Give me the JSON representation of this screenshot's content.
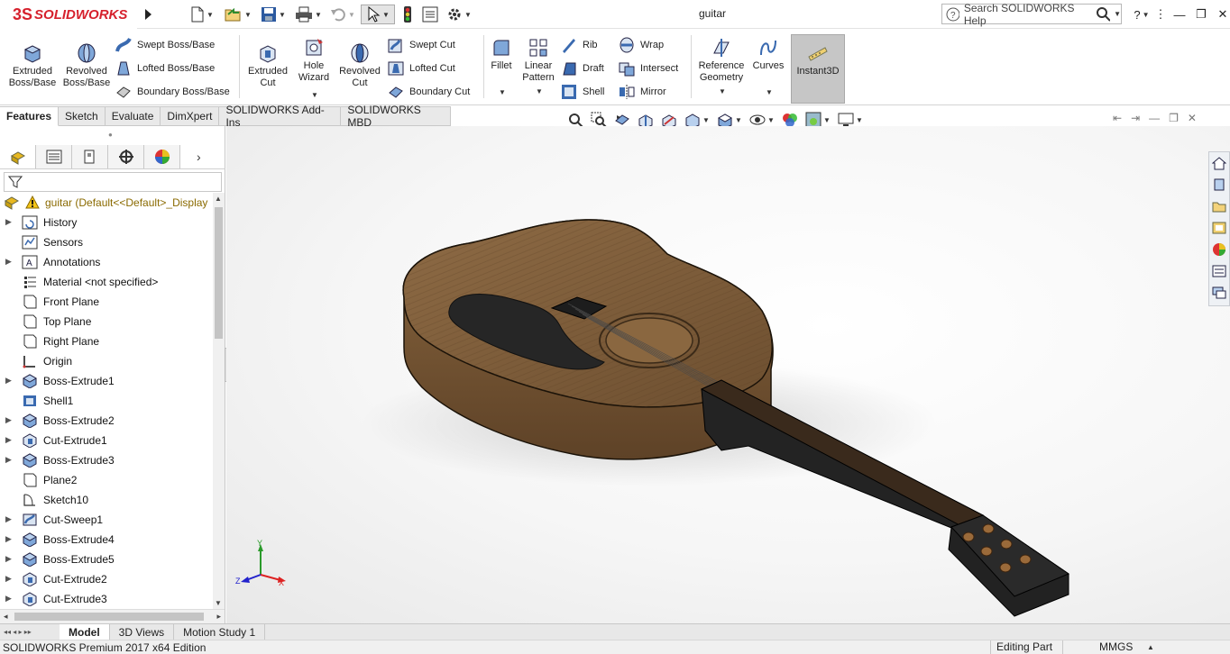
{
  "app": {
    "brand_ds": "3S",
    "brand_name": "SOLIDWORKS",
    "doc_title": "guitar",
    "search_placeholder": "Search SOLIDWORKS Help",
    "help_label": "?"
  },
  "quick_access": [
    "new-icon",
    "open-icon",
    "save-icon",
    "print-icon",
    "undo-icon",
    "select-icon",
    "rebuild-icon",
    "file-properties-icon",
    "options-icon"
  ],
  "command_manager": {
    "extruded_boss": "Extruded\nBoss/Base",
    "revolved_boss": "Revolved\nBoss/Base",
    "swept_boss": "Swept Boss/Base",
    "lofted_boss": "Lofted Boss/Base",
    "boundary_boss": "Boundary Boss/Base",
    "extruded_cut": "Extruded\nCut",
    "hole_wizard": "Hole\nWizard",
    "revolved_cut": "Revolved\nCut",
    "swept_cut": "Swept Cut",
    "lofted_cut": "Lofted Cut",
    "boundary_cut": "Boundary Cut",
    "fillet": "Fillet",
    "linear_pattern": "Linear\nPattern",
    "rib": "Rib",
    "draft": "Draft",
    "shell": "Shell",
    "wrap": "Wrap",
    "intersect": "Intersect",
    "mirror": "Mirror",
    "reference_geometry": "Reference\nGeometry",
    "curves": "Curves",
    "instant3d": "Instant3D"
  },
  "tabs": [
    "Features",
    "Sketch",
    "Evaluate",
    "DimXpert",
    "SOLIDWORKS Add-Ins",
    "SOLIDWORKS MBD"
  ],
  "active_tab": "Features",
  "tree": {
    "root": "guitar  (Default<<Default>_Display",
    "items": [
      {
        "label": "History",
        "expandable": true,
        "icon": "history-icon"
      },
      {
        "label": "Sensors",
        "expandable": false,
        "icon": "sensors-icon"
      },
      {
        "label": "Annotations",
        "expandable": true,
        "icon": "annotations-icon"
      },
      {
        "label": "Material <not specified>",
        "expandable": false,
        "icon": "material-icon"
      },
      {
        "label": "Front Plane",
        "expandable": false,
        "icon": "plane-icon"
      },
      {
        "label": "Top Plane",
        "expandable": false,
        "icon": "plane-icon"
      },
      {
        "label": "Right Plane",
        "expandable": false,
        "icon": "plane-icon"
      },
      {
        "label": "Origin",
        "expandable": false,
        "icon": "origin-icon"
      },
      {
        "label": "Boss-Extrude1",
        "expandable": true,
        "icon": "boss-extrude-icon"
      },
      {
        "label": "Shell1",
        "expandable": false,
        "icon": "shell-icon"
      },
      {
        "label": "Boss-Extrude2",
        "expandable": true,
        "icon": "boss-extrude-icon"
      },
      {
        "label": "Cut-Extrude1",
        "expandable": true,
        "icon": "cut-extrude-icon"
      },
      {
        "label": "Boss-Extrude3",
        "expandable": true,
        "icon": "boss-extrude-icon"
      },
      {
        "label": "Plane2",
        "expandable": false,
        "icon": "plane-icon"
      },
      {
        "label": "Sketch10",
        "expandable": false,
        "icon": "sketch-icon"
      },
      {
        "label": "Cut-Sweep1",
        "expandable": true,
        "icon": "cut-sweep-icon"
      },
      {
        "label": "Boss-Extrude4",
        "expandable": true,
        "icon": "boss-extrude-icon"
      },
      {
        "label": "Boss-Extrude5",
        "expandable": true,
        "icon": "boss-extrude-icon"
      },
      {
        "label": "Cut-Extrude2",
        "expandable": true,
        "icon": "cut-extrude-icon"
      },
      {
        "label": "Cut-Extrude3",
        "expandable": true,
        "icon": "cut-extrude-icon"
      }
    ]
  },
  "bottom_tabs": [
    "Model",
    "3D Views",
    "Motion Study 1"
  ],
  "active_bottom_tab": "Model",
  "status": {
    "edition": "SOLIDWORKS Premium 2017 x64 Edition",
    "mode": "Editing Part",
    "units": "MMGS"
  },
  "triad": {
    "x": "X",
    "y": "Y",
    "z": "Z"
  },
  "colors": {
    "brand_red": "#d6212d",
    "wood": "#7a5a38",
    "pickguard": "#2a2a2a",
    "neck": "#2b2b2b",
    "highlight": "#c6c6c6"
  }
}
